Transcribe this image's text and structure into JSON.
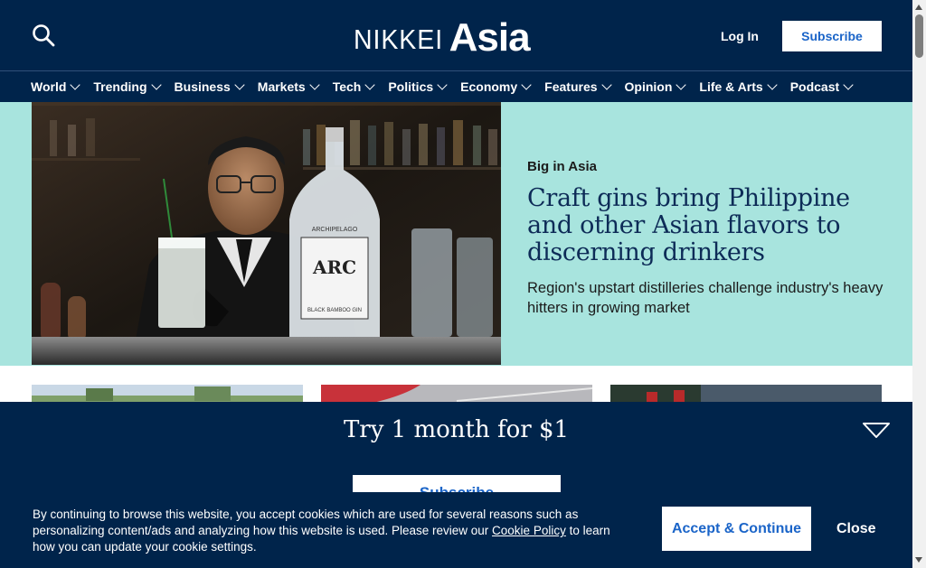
{
  "header": {
    "logo_nikkei": "NIKKEI",
    "logo_asia": "Asia",
    "login_label": "Log In",
    "subscribe_label": "Subscribe"
  },
  "nav": {
    "items": [
      {
        "label": "World"
      },
      {
        "label": "Trending"
      },
      {
        "label": "Business"
      },
      {
        "label": "Markets"
      },
      {
        "label": "Tech"
      },
      {
        "label": "Politics"
      },
      {
        "label": "Economy"
      },
      {
        "label": "Features"
      },
      {
        "label": "Opinion"
      },
      {
        "label": "Life & Arts"
      },
      {
        "label": "Podcast"
      }
    ]
  },
  "hero": {
    "kicker": "Big in Asia",
    "title": "Craft gins bring Philippine and other Asian flavors to discerning drinkers",
    "subtitle": "Region's upstart distilleries challenge industry's heavy hitters in growing market",
    "bottle_brand": "ARC",
    "bottle_label_top": "ARCHIPELAGO",
    "bottle_label_bottom": "BLACK BAMBOO GIN"
  },
  "promo": {
    "title": "Try 1 month for $1",
    "subscribe_label": "Subscribe"
  },
  "cookie": {
    "text_before": "By continuing to browse this website, you accept cookies which are used for several reasons such as personalizing content/ads and analyzing how this website is used. Please review our ",
    "link_label": "Cookie Policy",
    "text_after": " to learn how you can update your cookie settings.",
    "accept_label": "Accept & Continue",
    "close_label": "Close"
  },
  "colors": {
    "navy": "#00244b",
    "hero_bg": "#a8e4de",
    "link_blue": "#1a64c8",
    "headline": "#0d2b57"
  }
}
